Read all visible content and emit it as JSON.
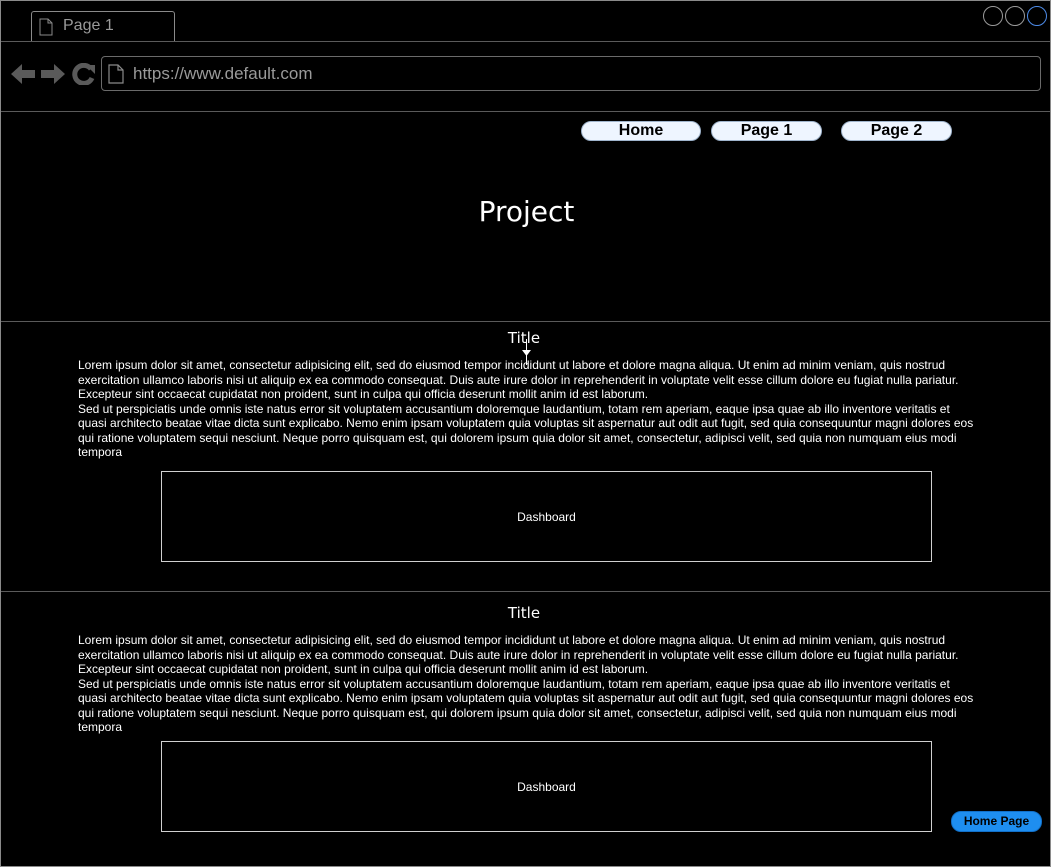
{
  "browser": {
    "tab_label": "Page 1",
    "url": "https://www.default.com"
  },
  "header": {
    "nav": [
      "Home",
      "Page 1",
      "Page 2"
    ],
    "title": "Project"
  },
  "sections": [
    {
      "title": "Title",
      "paragraph_1": "Lorem ipsum dolor sit amet, consectetur adipisicing elit, sed do eiusmod tempor incididunt ut labore et dolore magna aliqua. Ut enim ad minim veniam, quis nostrud exercitation ullamco laboris nisi ut aliquip ex ea commodo consequat. Duis aute irure dolor in reprehenderit in voluptate velit esse cillum dolore eu fugiat nulla pariatur. Excepteur sint occaecat cupidatat non proident, sunt in culpa qui officia deserunt mollit anim id est laborum.",
      "paragraph_2": "Sed ut perspiciatis unde omnis iste natus error sit voluptatem accusantium doloremque laudantium, totam rem aperiam, eaque ipsa quae ab illo inventore veritatis et quasi architecto beatae vitae dicta sunt explicabo. Nemo enim ipsam voluptatem quia voluptas sit aspernatur aut odit aut fugit, sed quia consequuntur magni dolores eos qui ratione voluptatem sequi nesciunt. Neque porro quisquam est, qui dolorem ipsum quia dolor sit amet, consectetur, adipisci velit, sed quia non numquam eius modi tempora",
      "dashboard_label": "Dashboard"
    },
    {
      "title": "Title",
      "paragraph_1": "Lorem ipsum dolor sit amet, consectetur adipisicing elit, sed do eiusmod tempor incididunt ut labore et dolore magna aliqua. Ut enim ad minim veniam, quis nostrud exercitation ullamco laboris nisi ut aliquip ex ea commodo consequat. Duis aute irure dolor in reprehenderit in voluptate velit esse cillum dolore eu fugiat nulla pariatur. Excepteur sint occaecat cupidatat non proident, sunt in culpa qui officia deserunt mollit anim id est laborum.",
      "paragraph_2": "Sed ut perspiciatis unde omnis iste natus error sit voluptatem accusantium doloremque laudantium, totam rem aperiam, eaque ipsa quae ab illo inventore veritatis et quasi architecto beatae vitae dicta sunt explicabo. Nemo enim ipsam voluptatem quia voluptas sit aspernatur aut odit aut fugit, sed quia consequuntur magni dolores eos qui ratione voluptatem sequi nesciunt. Neque porro quisquam est, qui dolorem ipsum quia dolor sit amet, consectetur, adipisci velit, sed quia non numquam eius modi tempora",
      "dashboard_label": "Dashboard"
    }
  ],
  "footer": {
    "home_page_label": "Home Page"
  },
  "colors": {
    "background": "#000000",
    "nav_pill": "#eef5ff",
    "home_page_button": "#1e8ef0",
    "active_window_control": "#4d8be8"
  }
}
